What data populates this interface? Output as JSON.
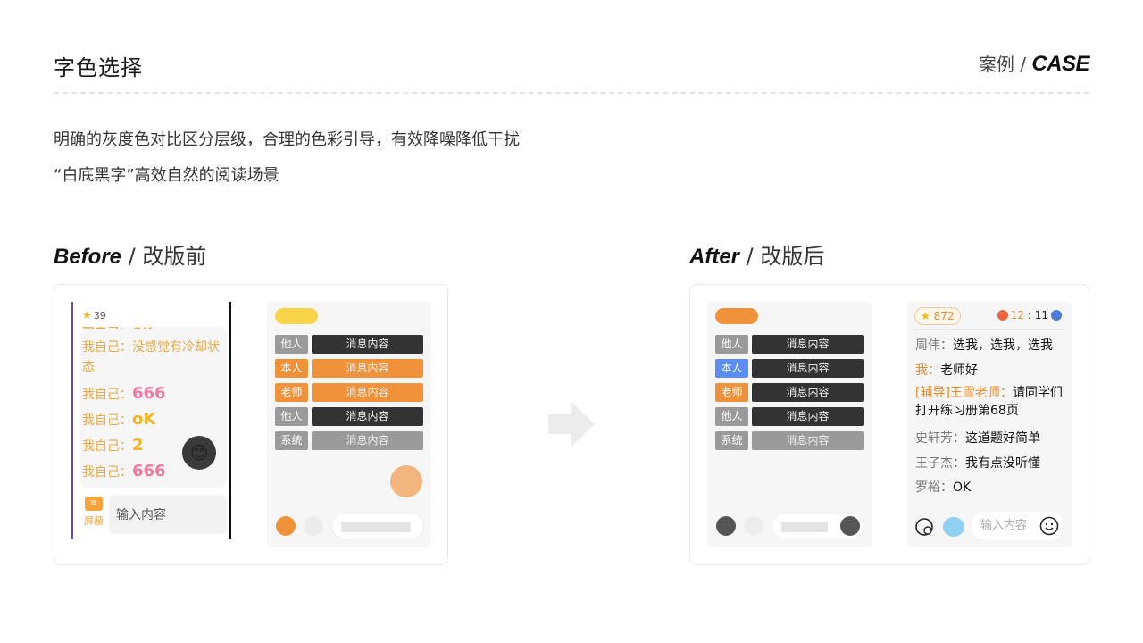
{
  "header": {
    "title": "字色选择",
    "case_cn": "案例 / ",
    "case_en": "CASE"
  },
  "description": [
    "明确的灰度色对比区分层级，合理的色彩引导，有效降噪降低干扰",
    "“白底黑字”高效自然的阅读场景"
  ],
  "before": {
    "title_en": "Before",
    "title_cn": " / 改版前",
    "phone": {
      "badge": "39",
      "messages": [
        {
          "prefix": "我自己：",
          "text": "没感觉有冷却状态"
        },
        {
          "prefix": "我自己：",
          "text": "666"
        },
        {
          "prefix": "我自己：",
          "text": "oK"
        },
        {
          "prefix": "我自己：",
          "text": "2"
        },
        {
          "prefix": "我自己：",
          "text": "666"
        }
      ],
      "shield_label": "屏蔽",
      "input_placeholder": "输入内容"
    },
    "wireframe": {
      "rows": [
        {
          "tag": "他人",
          "msg": "消息内容",
          "tag_color": "#9a9a9a",
          "msg_color": "#333333"
        },
        {
          "tag": "本人",
          "msg": "消息内容",
          "tag_color": "#f0923a",
          "msg_color": "#f0923a"
        },
        {
          "tag": "老师",
          "msg": "消息内容",
          "tag_color": "#f0923a",
          "msg_color": "#f0923a"
        },
        {
          "tag": "他人",
          "msg": "消息内容",
          "tag_color": "#9a9a9a",
          "msg_color": "#333333"
        },
        {
          "tag": "系统",
          "msg": "消息内容",
          "tag_color": "#9a9a9a",
          "msg_color": "#9a9a9a"
        }
      ]
    }
  },
  "after": {
    "title_en": "After",
    "title_cn": " / 改版后",
    "wireframe": {
      "rows": [
        {
          "tag": "他人",
          "msg": "消息内容",
          "tag_color": "#9a9a9a",
          "msg_color": "#333333"
        },
        {
          "tag": "本人",
          "msg": "消息内容",
          "tag_color": "#5b8ef0",
          "msg_color": "#333333"
        },
        {
          "tag": "老师",
          "msg": "消息内容",
          "tag_color": "#f0923a",
          "msg_color": "#333333"
        },
        {
          "tag": "他人",
          "msg": "消息内容",
          "tag_color": "#9a9a9a",
          "msg_color": "#333333"
        },
        {
          "tag": "系统",
          "msg": "消息内容",
          "tag_color": "#9a9a9a",
          "msg_color": "#9a9a9a"
        }
      ]
    },
    "phone": {
      "score": "872",
      "timer_left": "12",
      "timer_sep": " : ",
      "timer_right": "11",
      "messages": [
        {
          "name": "周伟：",
          "text": "选我，选我，选我"
        },
        {
          "name": "我：",
          "text": "老师好"
        },
        {
          "name": "[辅导]王雪老师：",
          "text": "请同学们打开练习册第68页"
        },
        {
          "name": "史轩芳：",
          "text": "这道题好简单"
        },
        {
          "name": "王子杰：",
          "text": "我有点没听懂"
        },
        {
          "name": "罗裕：",
          "text": "OK"
        }
      ],
      "input_placeholder": "输入内容"
    }
  },
  "colors": {
    "accent": "#f0923a",
    "yellow_pill": "#f9d44a",
    "blue_tag": "#5b8ef0"
  }
}
